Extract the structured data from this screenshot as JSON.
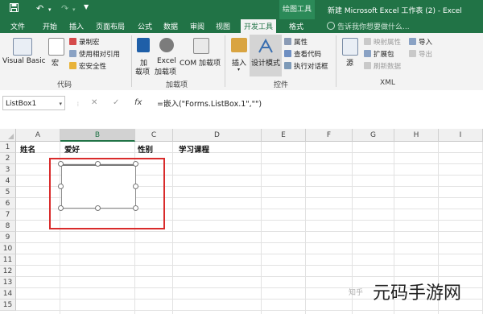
{
  "window": {
    "title": "新建 Microsoft Excel 工作表 (2) - Excel",
    "contextual_tab": "绘图工具"
  },
  "menu": {
    "items": [
      "文件",
      "开始",
      "插入",
      "页面布局",
      "公式",
      "数据",
      "审阅",
      "视图",
      "开发工具",
      "格式"
    ],
    "active": "开发工具",
    "search_placeholder": "告诉我你想要做什么..."
  },
  "ribbon": {
    "code_group": {
      "name": "代码",
      "visual_basic": "Visual Basic",
      "macros": "宏",
      "record_macro": "录制宏",
      "relative_ref": "使用相对引用",
      "macro_security": "宏安全性"
    },
    "addins_group": {
      "name": "加载项",
      "addins": "加载项",
      "addins_line1": "加",
      "addins_line2": "载项",
      "excel_addins_line1": "Excel",
      "excel_addins_line2": "加载项",
      "com_addins": "COM 加载项"
    },
    "controls_group": {
      "name": "控件",
      "insert": "插入",
      "design_mode": "设计模式",
      "properties": "属性",
      "view_code": "查看代码",
      "run_dialog": "执行对话框"
    },
    "xml_group": {
      "name": "XML",
      "source": "源",
      "map_properties": "映射属性",
      "expansion_packs": "扩展包",
      "refresh_data": "刷新数据",
      "import": "导入",
      "export": "导出"
    }
  },
  "formula_bar": {
    "name_box": "ListBox1",
    "cancel": "✕",
    "enter": "✓",
    "fx": "fx",
    "formula": "=嵌入(\"Forms.ListBox.1\",\"\")"
  },
  "sheet": {
    "columns": [
      "A",
      "B",
      "C",
      "D",
      "E",
      "F",
      "G",
      "H",
      "I"
    ],
    "selected_column": "B",
    "rows": [
      "1",
      "2",
      "3",
      "4",
      "5",
      "6",
      "7",
      "8",
      "9",
      "10",
      "11",
      "12",
      "13",
      "14",
      "15"
    ],
    "row1": {
      "A": "姓名",
      "B": "爱好",
      "C": "性别",
      "D": "学习课程"
    }
  },
  "watermark": {
    "site": "元码手游网",
    "source": "知乎"
  },
  "colors": {
    "accent": "#217346",
    "highlight_box": "#d92b2b"
  }
}
